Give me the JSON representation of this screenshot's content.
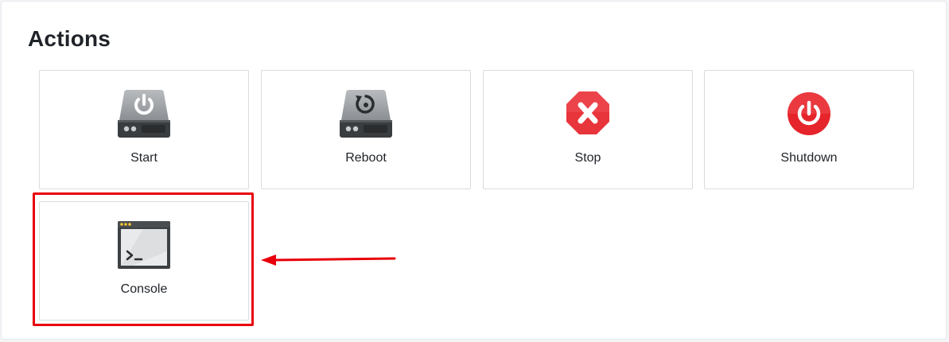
{
  "section": {
    "title": "Actions"
  },
  "actions": [
    {
      "id": "start",
      "label": "Start",
      "icon": "drive-power-icon"
    },
    {
      "id": "reboot",
      "label": "Reboot",
      "icon": "drive-reboot-icon"
    },
    {
      "id": "stop",
      "label": "Stop",
      "icon": "stop-icon"
    },
    {
      "id": "shutdown",
      "label": "Shutdown",
      "icon": "power-icon"
    },
    {
      "id": "console",
      "label": "Console",
      "icon": "terminal-icon"
    }
  ],
  "annotation": {
    "highlight_color": "#e8000b",
    "target": "console"
  },
  "colors": {
    "stop_red": "#e8343b",
    "shutdown_red": "#e5252b",
    "drive_gray": "#6e7276"
  }
}
